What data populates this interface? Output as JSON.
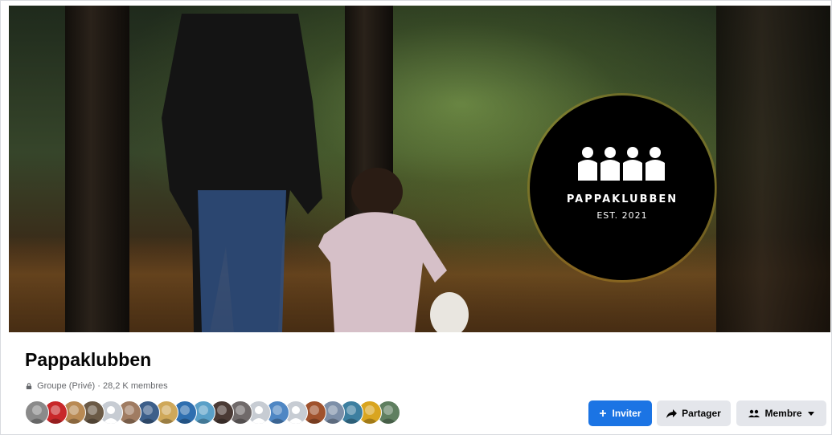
{
  "cover": {
    "logo_name": "PAPPAKLUBBEN",
    "logo_est": "EST. 2021"
  },
  "group": {
    "name": "Pappaklubben",
    "meta": "Groupe (Privé) · 28,2 K membres",
    "privacy_icon": "lock-icon"
  },
  "members_preview": {
    "avatars": [
      {
        "color": "#8a8a8a"
      },
      {
        "color": "#c8282a"
      },
      {
        "color": "#b98a54"
      },
      {
        "color": "#6b5a46"
      },
      {
        "color": "#c7ccd3",
        "placeholder": true
      },
      {
        "color": "#a07c62"
      },
      {
        "color": "#3d5f8a"
      },
      {
        "color": "#cfa85a"
      },
      {
        "color": "#2f6fb0"
      },
      {
        "color": "#5aa0c8"
      },
      {
        "color": "#4a3a35"
      },
      {
        "color": "#706a6a"
      },
      {
        "color": "#c7ccd3",
        "placeholder": true
      },
      {
        "color": "#4f87c4"
      },
      {
        "color": "#c7ccd3",
        "placeholder": true
      },
      {
        "color": "#a0522d"
      },
      {
        "color": "#7d8fa8"
      },
      {
        "color": "#3d7fa0"
      },
      {
        "color": "#d9a520"
      },
      {
        "color": "#5f7f60"
      }
    ]
  },
  "actions": {
    "invite_label": "Inviter",
    "invite_icon": "plus-icon",
    "share_label": "Partager",
    "share_icon": "share-arrow-icon",
    "member_label": "Membre",
    "member_icon": "members-icon",
    "member_dropdown_icon": "caret-down-icon"
  },
  "colors": {
    "primary": "#1b74e4",
    "secondary_bg": "#e4e6eb",
    "text_primary": "#050505",
    "text_secondary": "#65676b"
  }
}
